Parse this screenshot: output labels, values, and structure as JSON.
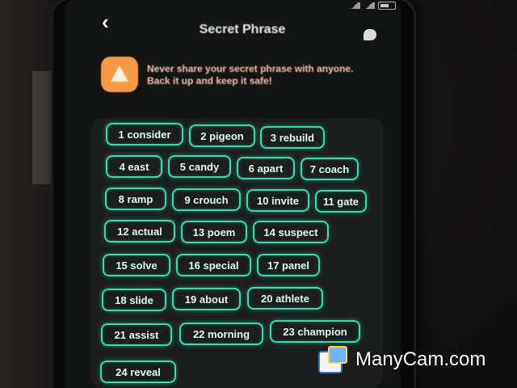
{
  "header": {
    "title": "Secret Phrase"
  },
  "warning": {
    "text_line1": "Never share your secret phrase with anyone.",
    "text_line2": "Back it up and keep it safe!"
  },
  "words": [
    {
      "label": "1 consider"
    },
    {
      "label": "2 pigeon"
    },
    {
      "label": "3 rebuild"
    },
    {
      "label": "4 east"
    },
    {
      "label": "5 candy"
    },
    {
      "label": "6 apart"
    },
    {
      "label": "7 coach"
    },
    {
      "label": "8 ramp"
    },
    {
      "label": "9 crouch"
    },
    {
      "label": "10 invite"
    },
    {
      "label": "11 gate"
    },
    {
      "label": "12 actual"
    },
    {
      "label": "13 poem"
    },
    {
      "label": "14 suspect"
    },
    {
      "label": "15 solve"
    },
    {
      "label": "16 special"
    },
    {
      "label": "17 panel"
    },
    {
      "label": "18 slide"
    },
    {
      "label": "19 about"
    },
    {
      "label": "20 athlete"
    },
    {
      "label": "21 assist"
    },
    {
      "label": "22 morning"
    },
    {
      "label": "23 champion"
    },
    {
      "label": "24 reveal"
    }
  ],
  "watermark": {
    "text": "ManyCam.com"
  },
  "colors": {
    "accent": "#2fe0b1",
    "warning": "#f59a43",
    "background": "#131414"
  }
}
